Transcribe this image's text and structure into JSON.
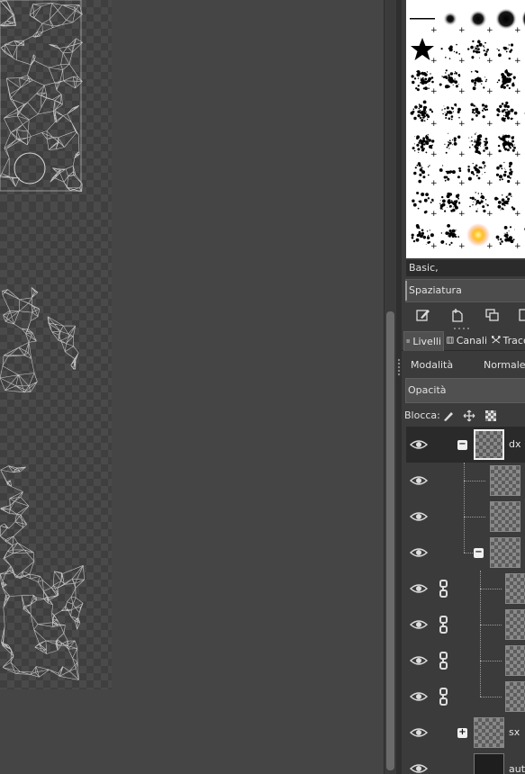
{
  "brushes": {
    "selected_name": "Basic,",
    "spacing_label": "Spaziatura"
  },
  "tabs": [
    {
      "label": "Livelli",
      "icon": "layers-icon"
    },
    {
      "label": "Canali",
      "icon": "channels-icon"
    },
    {
      "label": "Tracc",
      "icon": "paths-icon"
    }
  ],
  "layers_panel": {
    "mode_label": "Modalità",
    "mode_value": "Normale",
    "opacity_label": "Opacità",
    "lock_label": "Blocca:"
  },
  "layers": [
    {
      "name": "dx",
      "expander": "−",
      "selected": true
    },
    {
      "name": ""
    },
    {
      "name": ""
    },
    {
      "name": "",
      "expander": "−"
    },
    {
      "name": "",
      "chained": true
    },
    {
      "name": "",
      "chained": true
    },
    {
      "name": "",
      "chained": true
    },
    {
      "name": "",
      "chained": true
    },
    {
      "name": "sx",
      "expander": "+"
    },
    {
      "name": "aut"
    }
  ],
  "colors": {
    "canvas_bg": "#454545",
    "dock_bg": "#3b3b3b",
    "selected_row": "#2a2a2a",
    "wire": "#d8d8d8"
  }
}
